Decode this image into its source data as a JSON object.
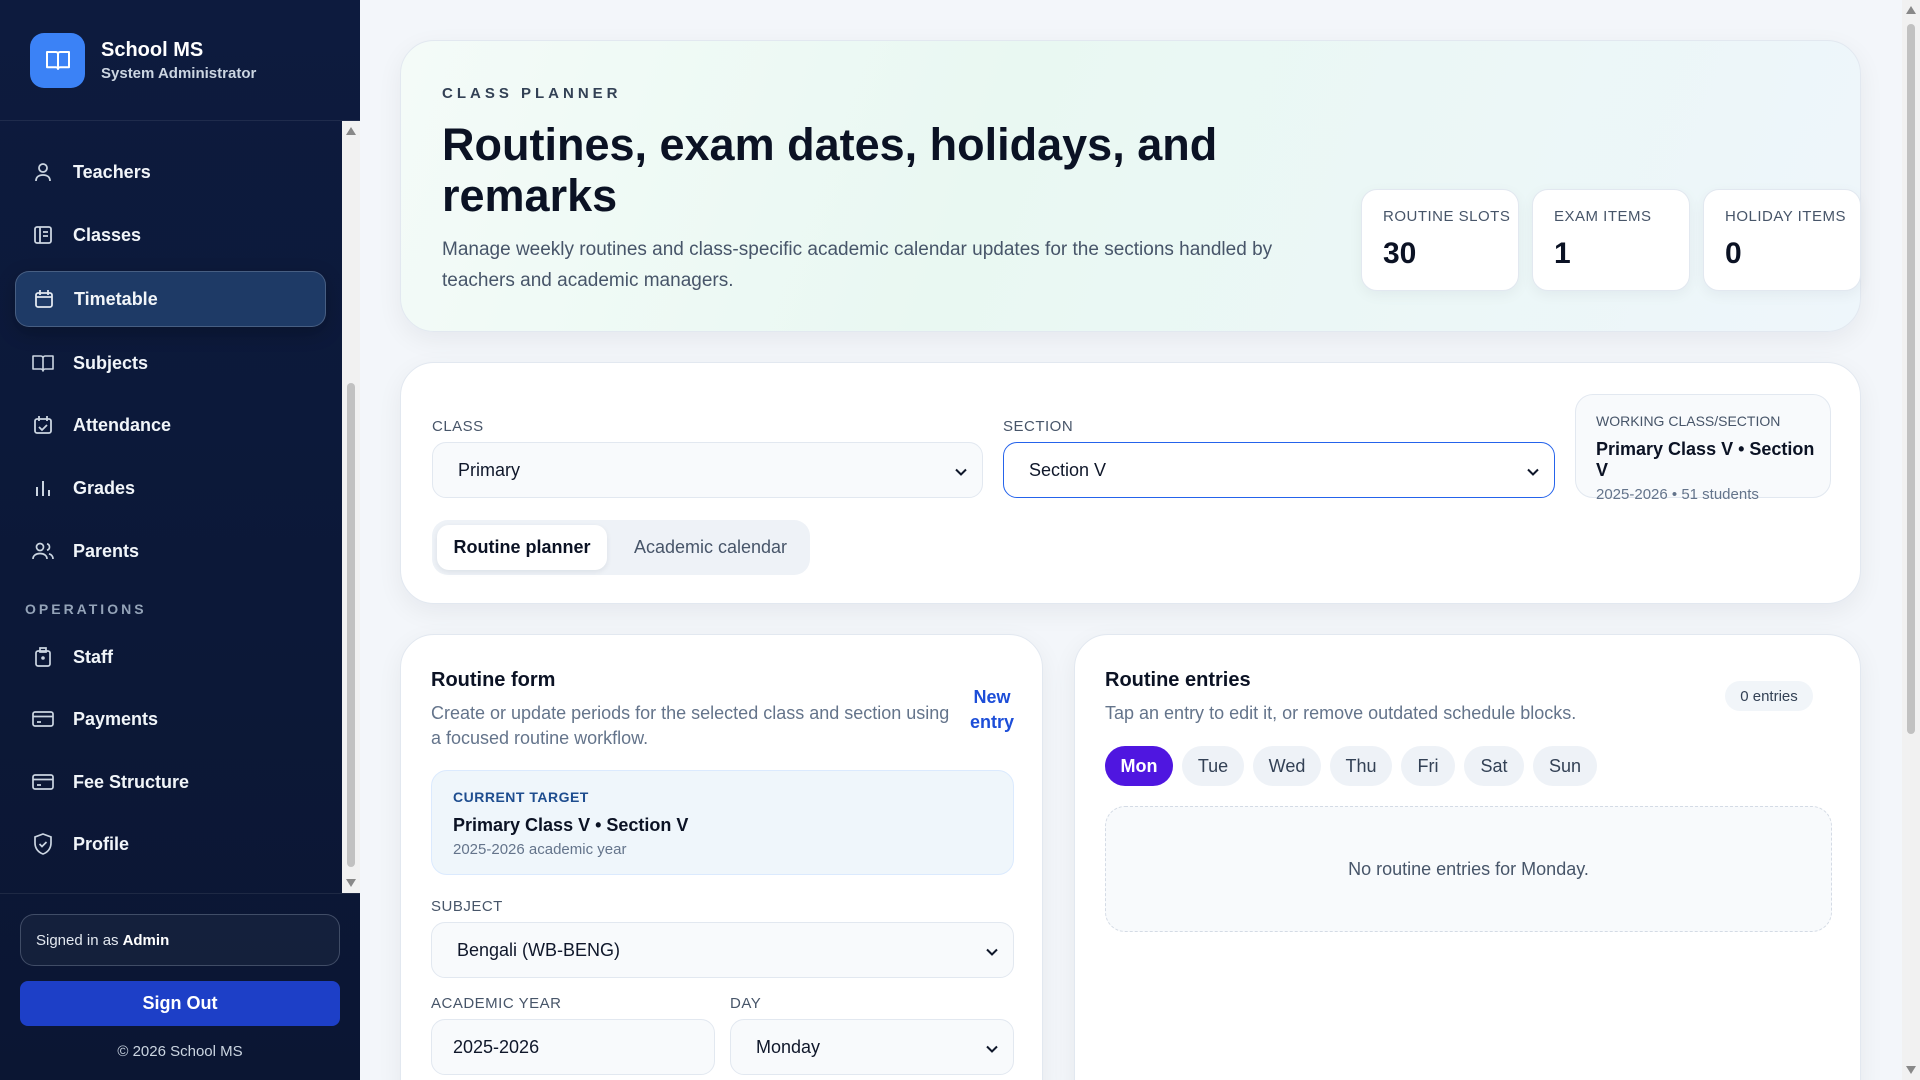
{
  "brand": {
    "title": "School MS",
    "subtitle": "System Administrator"
  },
  "sidebar": {
    "items": [
      {
        "label": "Teachers",
        "icon": "user-icon"
      },
      {
        "label": "Classes",
        "icon": "book-list-icon"
      },
      {
        "label": "Timetable",
        "icon": "calendar-icon",
        "active": true
      },
      {
        "label": "Subjects",
        "icon": "open-book-icon"
      },
      {
        "label": "Attendance",
        "icon": "calendar-check-icon"
      },
      {
        "label": "Grades",
        "icon": "bar-chart-icon"
      },
      {
        "label": "Parents",
        "icon": "users-icon"
      }
    ],
    "section_operations": "OPERATIONS",
    "ops_items": [
      {
        "label": "Staff",
        "icon": "badge-icon"
      },
      {
        "label": "Payments",
        "icon": "card-icon"
      },
      {
        "label": "Fee Structure",
        "icon": "card-icon"
      },
      {
        "label": "Profile",
        "icon": "shield-icon"
      }
    ],
    "signed_in_prefix": "Signed in as",
    "signed_in_user": "Admin",
    "sign_out": "Sign Out",
    "copyright": "© 2026 School MS"
  },
  "hero": {
    "eyebrow": "CLASS PLANNER",
    "title": "Routines, exam dates, holidays, and remarks",
    "description": "Manage weekly routines and class-specific academic calendar updates for the sections handled by teachers and academic managers.",
    "stats": [
      {
        "label": "ROUTINE SLOTS",
        "value": "30"
      },
      {
        "label": "EXAM ITEMS",
        "value": "1"
      },
      {
        "label": "HOLIDAY ITEMS",
        "value": "0"
      }
    ]
  },
  "filters": {
    "class_label": "CLASS",
    "class_value": "Primary",
    "section_label": "SECTION",
    "section_value": "Section V",
    "working_label": "WORKING CLASS/SECTION",
    "working_title": "Primary Class V • Section V",
    "working_sub": "2025-2026 • 51 students",
    "tabs": [
      "Routine planner",
      "Academic calendar"
    ]
  },
  "routine_form": {
    "title": "Routine form",
    "description": "Create or update periods for the selected class and section using a focused routine workflow.",
    "new_entry": "New entry",
    "target_label": "CURRENT TARGET",
    "target_title": "Primary Class V • Section V",
    "target_sub": "2025-2026 academic year",
    "subject_label": "SUBJECT",
    "subject_value": "Bengali (WB-BENG)",
    "year_label": "ACADEMIC YEAR",
    "year_value": "2025-2026",
    "day_label": "DAY",
    "day_value": "Monday"
  },
  "entries": {
    "title": "Routine entries",
    "description": "Tap an entry to edit it, or remove outdated schedule blocks.",
    "count": "0 entries",
    "days": [
      "Mon",
      "Tue",
      "Wed",
      "Thu",
      "Fri",
      "Sat",
      "Sun"
    ],
    "active_day": "Mon",
    "empty": "No routine entries for Monday."
  },
  "colors": {
    "accent": "#1d3fc7",
    "active_day": "#4f16e0",
    "sidebar": "#0d1b3e"
  }
}
